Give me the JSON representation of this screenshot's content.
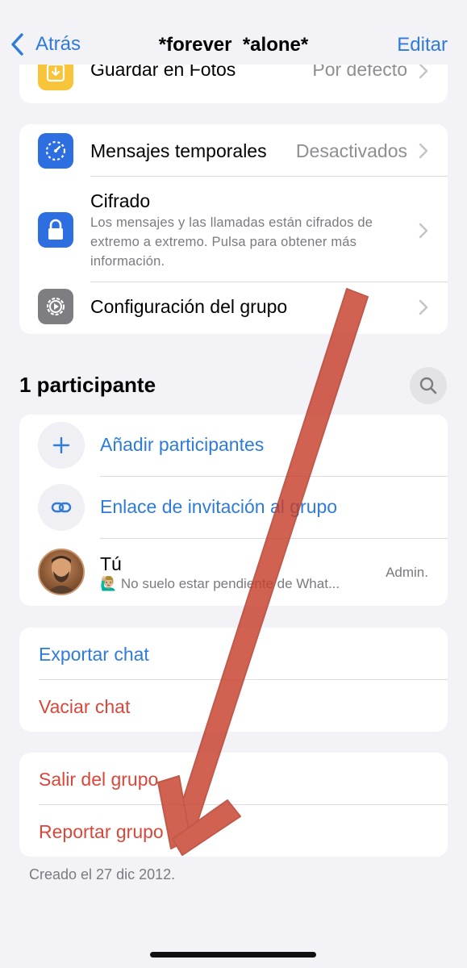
{
  "nav": {
    "back_label": "Atrás",
    "title": "*forever  *alone*",
    "edit_label": "Editar"
  },
  "save_photos": {
    "label": "Guardar en Fotos",
    "value": "Por defecto"
  },
  "settings": {
    "temp_messages_label": "Mensajes temporales",
    "temp_messages_value": "Desactivados",
    "encryption_label": "Cifrado",
    "encryption_desc_1": "Los mensajes y las llamadas están cifrados de",
    "encryption_desc_2": "extremo a extremo. Pulsa para obtener más",
    "encryption_desc_3": "información.",
    "group_settings_label": "Configuración del grupo"
  },
  "participants": {
    "header": "1 participante",
    "add_label": "Añadir participantes",
    "invite_label": "Enlace de invitación al grupo",
    "user_name": "Tú",
    "user_status": "🙋🏼‍♂️ No suelo estar pendiente de What...",
    "user_role": "Admin."
  },
  "chat_actions": {
    "export_label": "Exportar chat",
    "clear_label": "Vaciar chat"
  },
  "group_actions": {
    "exit_label": "Salir del grupo",
    "report_label": "Reportar grupo"
  },
  "footer": {
    "created": "Creado el 27 dic 2012."
  },
  "colors": {
    "accent_blue": "#2f7bd9",
    "destructive_red": "#d9473a",
    "annotation_arrow": "#c8402c"
  }
}
